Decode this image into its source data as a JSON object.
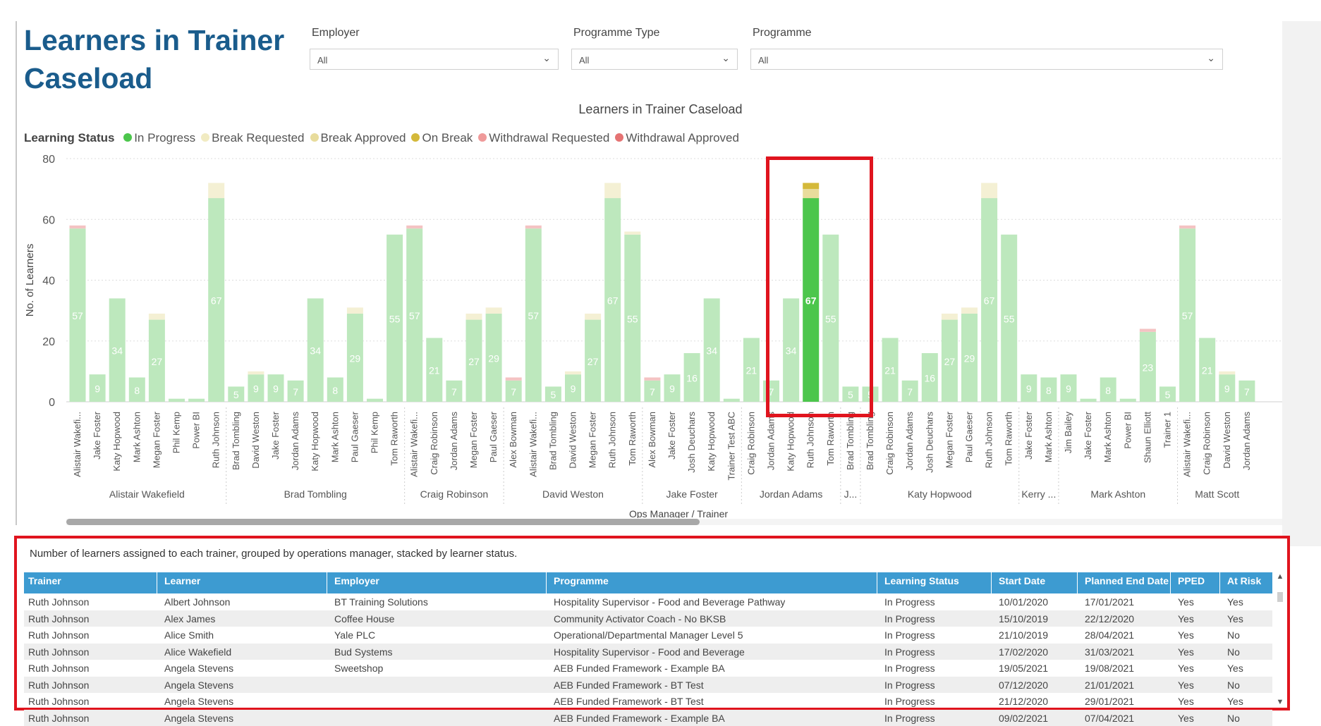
{
  "page": {
    "title": "Learners in Trainer Caseload"
  },
  "filters": [
    {
      "label": "Employer",
      "value": "All"
    },
    {
      "label": "Programme Type",
      "value": "All"
    },
    {
      "label": "Programme",
      "value": "All"
    }
  ],
  "chart_data": {
    "type": "bar",
    "stacked": true,
    "title": "Learners in Trainer Caseload",
    "xlabel": "Ops Manager / Trainer",
    "ylabel": "No. of Learners",
    "ylim": [
      0,
      80
    ],
    "yticks": [
      0,
      20,
      40,
      60,
      80
    ],
    "grid": true,
    "legend_title": "Learning Status",
    "legend_position": "top-left",
    "legend": [
      {
        "name": "In Progress",
        "color": "#4cc64c"
      },
      {
        "name": "Break Requested",
        "color": "#f1ebc2"
      },
      {
        "name": "Break Approved",
        "color": "#e8dc9c"
      },
      {
        "name": "On Break",
        "color": "#d4b93a"
      },
      {
        "name": "Withdrawal Requested",
        "color": "#ef9a9a"
      },
      {
        "name": "Withdrawal Approved",
        "color": "#e57373"
      }
    ],
    "groups": [
      {
        "name": "Alistair Wakefield",
        "trainers": [
          "Alistair Wakefi...",
          "Jake Foster",
          "Katy Hopwood",
          "Mark Ashton",
          "Megan Foster",
          "Phil Kemp",
          "Power BI",
          "Ruth Johnson"
        ]
      },
      {
        "name": "Brad Tombling",
        "trainers": [
          "Brad Tombling",
          "David Weston",
          "Jake Foster",
          "Jordan Adams",
          "Katy Hopwood",
          "Mark Ashton",
          "Paul Gaeser",
          "Phil Kemp",
          "Tom Raworth"
        ]
      },
      {
        "name": "Craig Robinson",
        "trainers": [
          "Alistair Wakefi...",
          "Craig Robinson",
          "Jordan Adams",
          "Megan Foster",
          "Paul Gaeser"
        ]
      },
      {
        "name": "David Weston",
        "trainers": [
          "Alex Bowman",
          "Alistair Wakefi...",
          "Brad Tombling",
          "David Weston",
          "Megan Foster",
          "Ruth Johnson",
          "Tom Raworth"
        ]
      },
      {
        "name": "Jake Foster",
        "trainers": [
          "Alex Bowman",
          "Jake Foster",
          "Josh Deuchars",
          "Katy Hopwood",
          "Trainer Test ABC"
        ]
      },
      {
        "name": "Jordan Adams",
        "trainers": [
          "Craig Robinson",
          "Jordan Adams",
          "Katy Hopwood",
          "Ruth Johnson",
          "Tom Raworth"
        ]
      },
      {
        "name": "J...",
        "trainers": [
          "Brad Tombling"
        ]
      },
      {
        "name": "Katy Hopwood",
        "trainers": [
          "Brad Tombling",
          "Craig Robinson",
          "Jordan Adams",
          "Josh Deuchars",
          "Megan Foster",
          "Paul Gaeser",
          "Ruth Johnson",
          "Tom Raworth"
        ]
      },
      {
        "name": "Kerry ...",
        "trainers": [
          "Jake Foster",
          "Mark Ashton"
        ]
      },
      {
        "name": "Mark Ashton",
        "trainers": [
          "Jim Bailey",
          "Jake Foster",
          "Mark Ashton",
          "Power BI",
          "Shaun Elliott",
          "Trainer 1"
        ]
      },
      {
        "name": "Matt Scott",
        "trainers": [
          "Alistair Wakefi...",
          "Craig Robinson",
          "David Weston",
          "Jordan Adams"
        ]
      }
    ],
    "series": [
      {
        "name": "In Progress",
        "values": [
          57,
          9,
          34,
          8,
          27,
          1,
          1,
          67,
          5,
          9,
          9,
          7,
          34,
          8,
          29,
          1,
          55,
          57,
          21,
          7,
          27,
          29,
          7,
          57,
          5,
          9,
          27,
          67,
          55,
          7,
          9,
          16,
          34,
          1,
          21,
          7,
          34,
          67,
          55,
          5,
          5,
          21,
          7,
          16,
          27,
          29,
          67,
          55,
          9,
          8,
          9,
          1,
          8,
          1,
          23,
          5,
          57,
          21,
          9,
          7
        ]
      },
      {
        "name": "Break Requested",
        "values": [
          0,
          0,
          0,
          0,
          2,
          0,
          0,
          5,
          0,
          1,
          0,
          0,
          0,
          0,
          2,
          0,
          0,
          0,
          0,
          0,
          2,
          2,
          0,
          0,
          0,
          1,
          2,
          5,
          1,
          0,
          0,
          0,
          0,
          0,
          0,
          0,
          0,
          0,
          0,
          0,
          0,
          0,
          0,
          0,
          2,
          2,
          5,
          0,
          0,
          0,
          0,
          0,
          0,
          0,
          0,
          0,
          0,
          0,
          1,
          0
        ]
      },
      {
        "name": "Break Approved",
        "values": [
          0,
          0,
          0,
          0,
          0,
          0,
          0,
          0,
          0,
          0,
          0,
          0,
          0,
          0,
          0,
          0,
          0,
          0,
          0,
          0,
          0,
          0,
          0,
          0,
          0,
          0,
          0,
          0,
          0,
          0,
          0,
          0,
          0,
          0,
          0,
          0,
          0,
          3,
          0,
          0,
          0,
          0,
          0,
          0,
          0,
          0,
          0,
          0,
          0,
          0,
          0,
          0,
          0,
          0,
          0,
          0,
          0,
          0,
          0,
          0
        ]
      },
      {
        "name": "On Break",
        "values": [
          0,
          0,
          0,
          0,
          0,
          0,
          0,
          0,
          0,
          0,
          0,
          0,
          0,
          0,
          0,
          0,
          0,
          0,
          0,
          0,
          0,
          0,
          0,
          0,
          0,
          0,
          0,
          0,
          0,
          0,
          0,
          0,
          0,
          0,
          0,
          0,
          0,
          2,
          0,
          0,
          0,
          0,
          0,
          0,
          0,
          0,
          0,
          0,
          0,
          0,
          0,
          0,
          0,
          0,
          0,
          0,
          0,
          0,
          0,
          0
        ]
      },
      {
        "name": "Withdrawal Requested",
        "values": [
          1,
          0,
          0,
          0,
          0,
          0,
          0,
          0,
          0,
          0,
          0,
          0,
          0,
          0,
          0,
          0,
          0,
          1,
          0,
          0,
          0,
          0,
          1,
          1,
          0,
          0,
          0,
          0,
          0,
          1,
          0,
          0,
          0,
          0,
          0,
          0,
          0,
          0,
          0,
          0,
          0,
          0,
          0,
          0,
          0,
          0,
          0,
          0,
          0,
          0,
          0,
          0,
          0,
          0,
          1,
          0,
          1,
          0,
          0,
          0
        ]
      },
      {
        "name": "Withdrawal Approved",
        "values": [
          0,
          0,
          0,
          0,
          0,
          0,
          0,
          0,
          0,
          0,
          0,
          0,
          0,
          0,
          0,
          0,
          0,
          0,
          0,
          0,
          0,
          0,
          0,
          0,
          0,
          0,
          0,
          0,
          0,
          0,
          0,
          0,
          0,
          0,
          0,
          0,
          0,
          0,
          0,
          0,
          0,
          0,
          0,
          0,
          0,
          0,
          0,
          0,
          0,
          0,
          0,
          0,
          0,
          0,
          0,
          0,
          0,
          0,
          0,
          0
        ]
      }
    ],
    "selected_index": 37
  },
  "table": {
    "caption": "Number of learners assigned to each trainer, grouped by operations manager, stacked by learner status.",
    "columns": [
      "Trainer",
      "Learner",
      "Employer",
      "Programme",
      "Learning Status",
      "Start Date",
      "Planned End Date",
      "PPED",
      "At Risk"
    ],
    "rows": [
      [
        "Ruth Johnson",
        "Albert Johnson",
        "BT Training Solutions",
        "Hospitality Supervisor - Food and Beverage Pathway",
        "In Progress",
        "10/01/2020",
        "17/01/2021",
        "Yes",
        "Yes"
      ],
      [
        "Ruth Johnson",
        "Alex James",
        "Coffee House",
        "Community Activator Coach - No BKSB",
        "In Progress",
        "15/10/2019",
        "22/12/2020",
        "Yes",
        "Yes"
      ],
      [
        "Ruth Johnson",
        "Alice Smith",
        "Yale PLC",
        "Operational/Departmental Manager Level 5",
        "In Progress",
        "21/10/2019",
        "28/04/2021",
        "Yes",
        "No"
      ],
      [
        "Ruth Johnson",
        "Alice Wakefield",
        "Bud Systems",
        "Hospitality Supervisor - Food and Beverage",
        "In Progress",
        "17/02/2020",
        "31/03/2021",
        "Yes",
        "No"
      ],
      [
        "Ruth Johnson",
        "Angela Stevens",
        "Sweetshop",
        "AEB Funded Framework - Example BA",
        "In Progress",
        "19/05/2021",
        "19/08/2021",
        "Yes",
        "Yes"
      ],
      [
        "Ruth Johnson",
        "Angela Stevens",
        "",
        "AEB Funded Framework - BT Test",
        "In Progress",
        "07/12/2020",
        "21/01/2021",
        "Yes",
        "No"
      ],
      [
        "Ruth Johnson",
        "Angela Stevens",
        "",
        "AEB Funded Framework - BT Test",
        "In Progress",
        "21/12/2020",
        "29/01/2021",
        "Yes",
        "Yes"
      ],
      [
        "Ruth Johnson",
        "Angela Stevens",
        "",
        "AEB Funded Framework - Example BA",
        "In Progress",
        "09/02/2021",
        "07/04/2021",
        "Yes",
        "No"
      ]
    ]
  }
}
